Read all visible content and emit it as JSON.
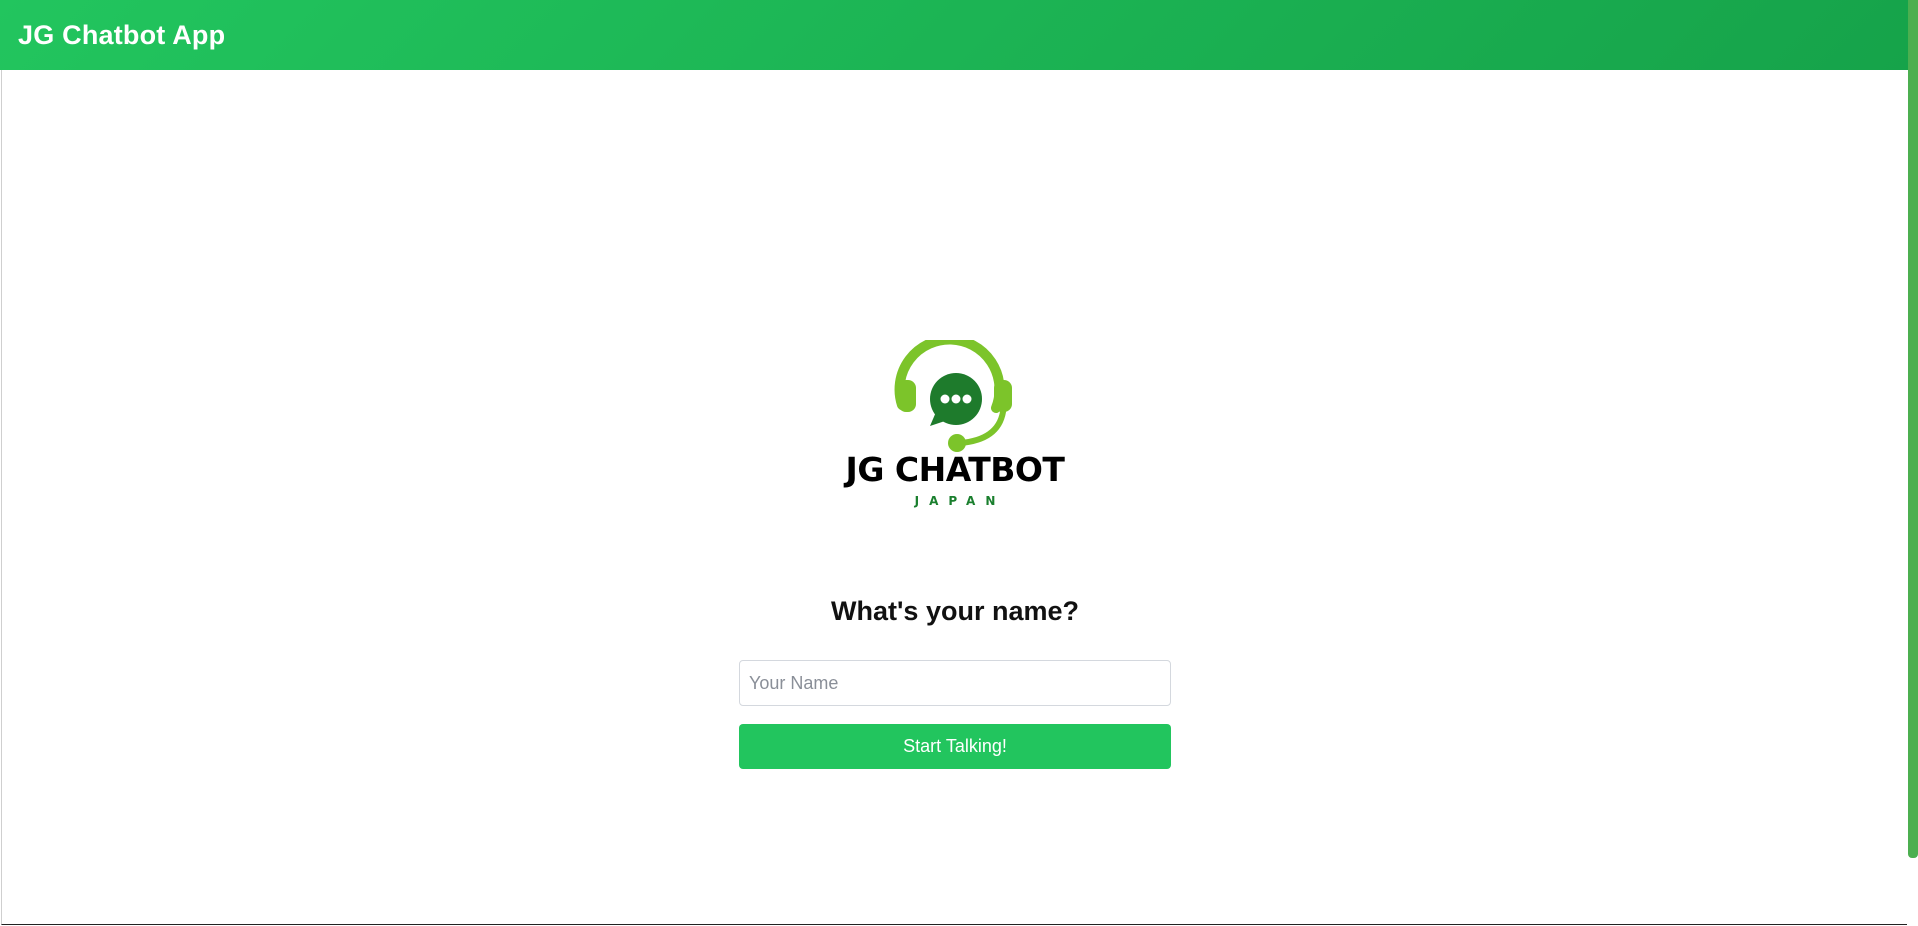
{
  "header": {
    "title": "JG Chatbot App"
  },
  "logo": {
    "icon": "headset-chat-bubble-icon",
    "brand_text": "JG CHATBOT",
    "sub_text": "JAPAN"
  },
  "form": {
    "question": "What's your name?",
    "name_placeholder": "Your Name",
    "name_value": "",
    "submit_label": "Start Talking!"
  },
  "colors": {
    "header_start": "#22c55e",
    "header_end": "#16a34a",
    "button": "#22c55e",
    "logo_light_green": "#7cc42a",
    "logo_dark_green": "#1a7f2e",
    "scrollbar": "#4caf50"
  }
}
